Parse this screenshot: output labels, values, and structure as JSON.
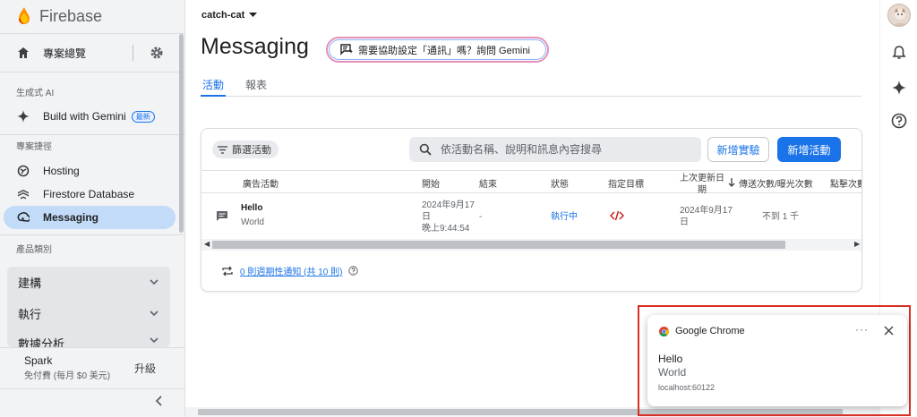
{
  "sidebar": {
    "brand": "Firebase",
    "overview_label": "專案總覽",
    "section_ai": "生成式 AI",
    "gemini_label": "Build with Gemini",
    "gemini_badge": "最新",
    "section_shortcuts": "專案捷徑",
    "shortcuts": [
      {
        "label": "Hosting",
        "icon": "hosting-icon"
      },
      {
        "label": "Firestore Database",
        "icon": "firestore-icon"
      },
      {
        "label": "Messaging",
        "icon": "messaging-icon",
        "active": true
      }
    ],
    "section_categories": "產品類別",
    "categories": [
      {
        "label": "建構"
      },
      {
        "label": "執行"
      },
      {
        "label": "數據分析"
      }
    ],
    "plan_name": "Spark",
    "plan_desc": "免付費 (每月 $0 美元)",
    "upgrade_label": "升級"
  },
  "header": {
    "project_name": "catch-cat",
    "page_title": "Messaging",
    "gemini_prompt": "需要協助設定「通訊」嗎？詢問 Gemini"
  },
  "tabs": [
    {
      "label": "活動",
      "active": true
    },
    {
      "label": "報表",
      "active": false
    }
  ],
  "toolbar": {
    "filter_label": "篩選活動",
    "search_placeholder": "依活動名稱、說明和訊息內容搜尋",
    "experiment_label": "新增實驗",
    "new_campaign_label": "新增活動"
  },
  "table": {
    "columns": [
      "廣告活動",
      "開始",
      "結束",
      "狀態",
      "指定目標",
      "上次更新日期",
      "傳送次數/曝光次數",
      "點擊次數"
    ],
    "rows": [
      {
        "title": "Hello",
        "body": "World",
        "start_line1": "2024年9月17",
        "start_line2": "日",
        "start_line3": "晚上9:44:54",
        "end": "-",
        "status": "執行中",
        "updated_line1": "2024年9月17",
        "updated_line2": "日",
        "sends": "不到 1 千"
      }
    ]
  },
  "recurring": {
    "link_label": "0 則週期性通知 (共 10 則)"
  },
  "notification": {
    "app": "Google Chrome",
    "more": "···",
    "title": "Hello",
    "body": "World",
    "origin": "localhost:60122"
  },
  "colors": {
    "accent": "#1a73e8",
    "active_nav": "#c2dbf8",
    "status_running": "#1a73e8",
    "highlight_frame": "#d93025"
  }
}
